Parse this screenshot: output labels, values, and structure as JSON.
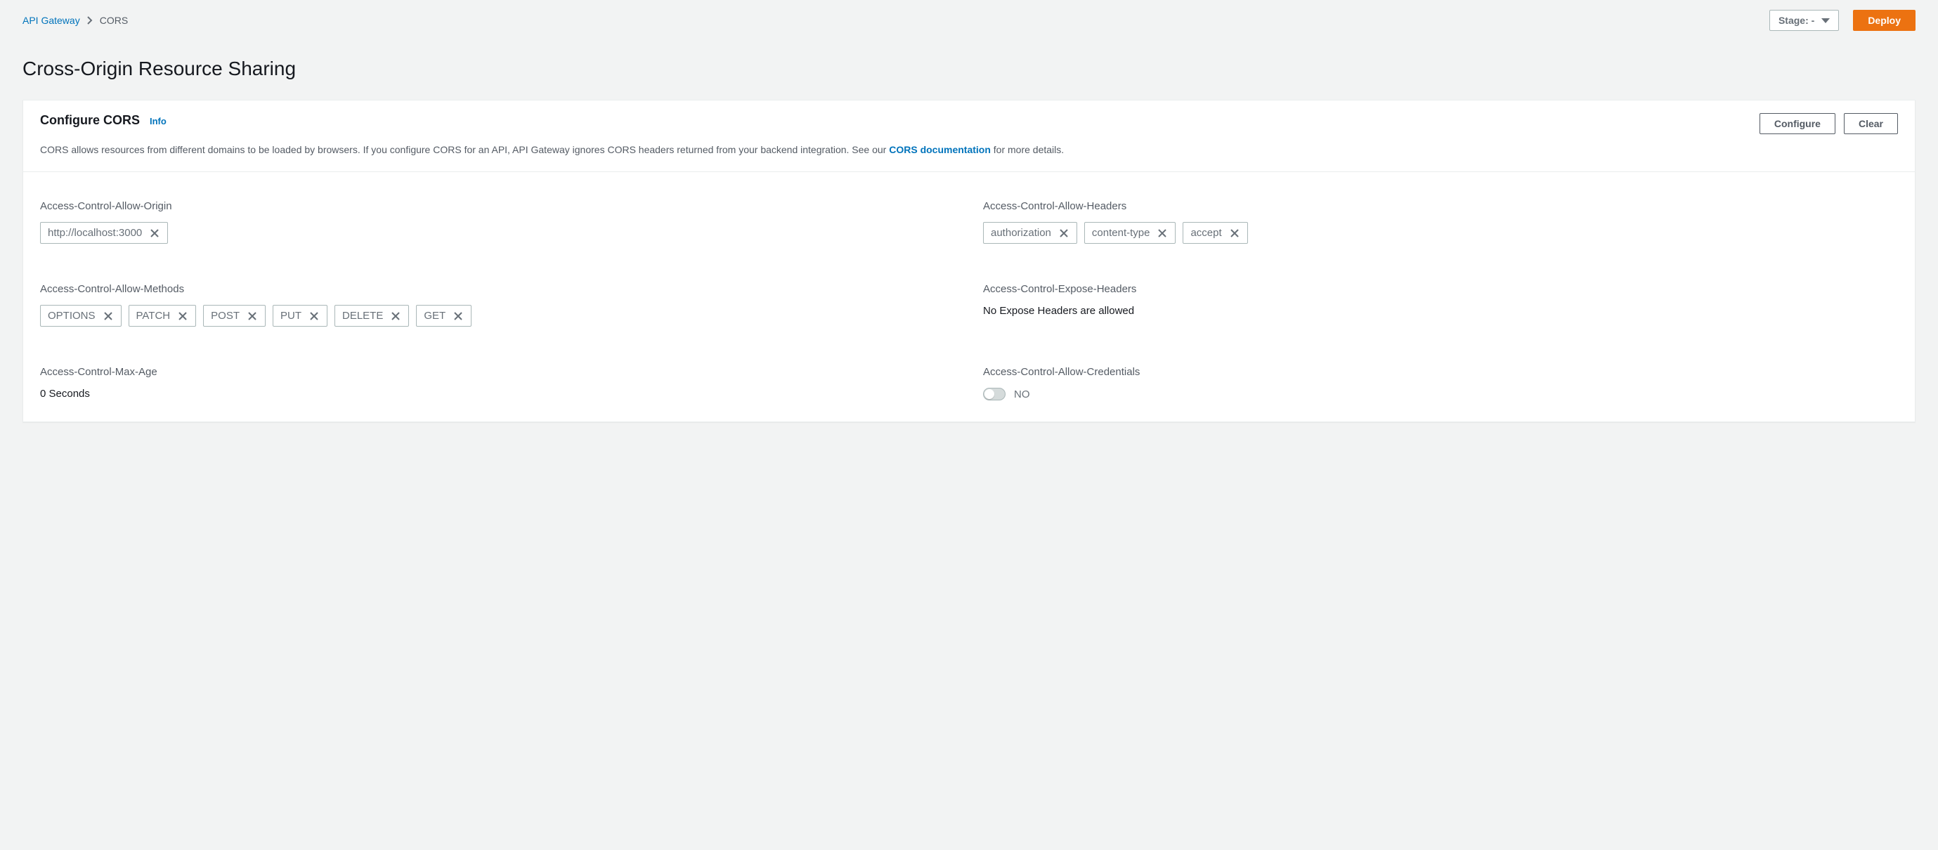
{
  "breadcrumb": {
    "root": "API Gateway",
    "current": "CORS"
  },
  "topbar": {
    "stage_label": "Stage: -",
    "deploy_label": "Deploy"
  },
  "page": {
    "title": "Cross-Origin Resource Sharing"
  },
  "panel": {
    "title": "Configure CORS",
    "info_label": "Info",
    "configure_label": "Configure",
    "clear_label": "Clear",
    "description_prefix": "CORS allows resources from different domains to be loaded by browsers. If you configure CORS for an API, API Gateway ignores CORS headers returned from your backend integration. See our ",
    "description_link": "CORS documentation",
    "description_suffix": " for more details."
  },
  "fields": {
    "allow_origin": {
      "label": "Access-Control-Allow-Origin",
      "tokens": [
        "http://localhost:3000"
      ]
    },
    "allow_headers": {
      "label": "Access-Control-Allow-Headers",
      "tokens": [
        "authorization",
        "content-type",
        "accept"
      ]
    },
    "allow_methods": {
      "label": "Access-Control-Allow-Methods",
      "tokens": [
        "OPTIONS",
        "PATCH",
        "POST",
        "PUT",
        "DELETE",
        "GET"
      ]
    },
    "expose_headers": {
      "label": "Access-Control-Expose-Headers",
      "empty_text": "No Expose Headers are allowed"
    },
    "max_age": {
      "label": "Access-Control-Max-Age",
      "value": "0 Seconds"
    },
    "allow_credentials": {
      "label": "Access-Control-Allow-Credentials",
      "value": "NO"
    }
  }
}
